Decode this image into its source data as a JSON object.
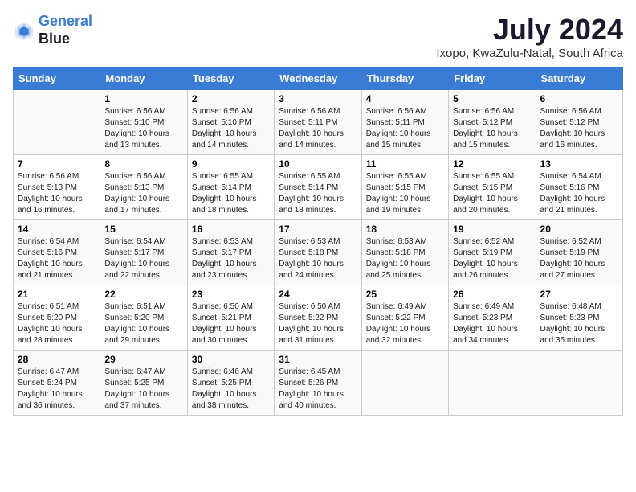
{
  "logo": {
    "line1": "General",
    "line2": "Blue"
  },
  "title": {
    "month": "July 2024",
    "location": "Ixopo, KwaZulu-Natal, South Africa"
  },
  "headers": [
    "Sunday",
    "Monday",
    "Tuesday",
    "Wednesday",
    "Thursday",
    "Friday",
    "Saturday"
  ],
  "weeks": [
    [
      {
        "day": "",
        "sunrise": "",
        "sunset": "",
        "daylight": ""
      },
      {
        "day": "1",
        "sunrise": "Sunrise: 6:56 AM",
        "sunset": "Sunset: 5:10 PM",
        "daylight": "Daylight: 10 hours and 13 minutes."
      },
      {
        "day": "2",
        "sunrise": "Sunrise: 6:56 AM",
        "sunset": "Sunset: 5:10 PM",
        "daylight": "Daylight: 10 hours and 14 minutes."
      },
      {
        "day": "3",
        "sunrise": "Sunrise: 6:56 AM",
        "sunset": "Sunset: 5:11 PM",
        "daylight": "Daylight: 10 hours and 14 minutes."
      },
      {
        "day": "4",
        "sunrise": "Sunrise: 6:56 AM",
        "sunset": "Sunset: 5:11 PM",
        "daylight": "Daylight: 10 hours and 15 minutes."
      },
      {
        "day": "5",
        "sunrise": "Sunrise: 6:56 AM",
        "sunset": "Sunset: 5:12 PM",
        "daylight": "Daylight: 10 hours and 15 minutes."
      },
      {
        "day": "6",
        "sunrise": "Sunrise: 6:56 AM",
        "sunset": "Sunset: 5:12 PM",
        "daylight": "Daylight: 10 hours and 16 minutes."
      }
    ],
    [
      {
        "day": "7",
        "sunrise": "Sunrise: 6:56 AM",
        "sunset": "Sunset: 5:13 PM",
        "daylight": "Daylight: 10 hours and 16 minutes."
      },
      {
        "day": "8",
        "sunrise": "Sunrise: 6:56 AM",
        "sunset": "Sunset: 5:13 PM",
        "daylight": "Daylight: 10 hours and 17 minutes."
      },
      {
        "day": "9",
        "sunrise": "Sunrise: 6:55 AM",
        "sunset": "Sunset: 5:14 PM",
        "daylight": "Daylight: 10 hours and 18 minutes."
      },
      {
        "day": "10",
        "sunrise": "Sunrise: 6:55 AM",
        "sunset": "Sunset: 5:14 PM",
        "daylight": "Daylight: 10 hours and 18 minutes."
      },
      {
        "day": "11",
        "sunrise": "Sunrise: 6:55 AM",
        "sunset": "Sunset: 5:15 PM",
        "daylight": "Daylight: 10 hours and 19 minutes."
      },
      {
        "day": "12",
        "sunrise": "Sunrise: 6:55 AM",
        "sunset": "Sunset: 5:15 PM",
        "daylight": "Daylight: 10 hours and 20 minutes."
      },
      {
        "day": "13",
        "sunrise": "Sunrise: 6:54 AM",
        "sunset": "Sunset: 5:16 PM",
        "daylight": "Daylight: 10 hours and 21 minutes."
      }
    ],
    [
      {
        "day": "14",
        "sunrise": "Sunrise: 6:54 AM",
        "sunset": "Sunset: 5:16 PM",
        "daylight": "Daylight: 10 hours and 21 minutes."
      },
      {
        "day": "15",
        "sunrise": "Sunrise: 6:54 AM",
        "sunset": "Sunset: 5:17 PM",
        "daylight": "Daylight: 10 hours and 22 minutes."
      },
      {
        "day": "16",
        "sunrise": "Sunrise: 6:53 AM",
        "sunset": "Sunset: 5:17 PM",
        "daylight": "Daylight: 10 hours and 23 minutes."
      },
      {
        "day": "17",
        "sunrise": "Sunrise: 6:53 AM",
        "sunset": "Sunset: 5:18 PM",
        "daylight": "Daylight: 10 hours and 24 minutes."
      },
      {
        "day": "18",
        "sunrise": "Sunrise: 6:53 AM",
        "sunset": "Sunset: 5:18 PM",
        "daylight": "Daylight: 10 hours and 25 minutes."
      },
      {
        "day": "19",
        "sunrise": "Sunrise: 6:52 AM",
        "sunset": "Sunset: 5:19 PM",
        "daylight": "Daylight: 10 hours and 26 minutes."
      },
      {
        "day": "20",
        "sunrise": "Sunrise: 6:52 AM",
        "sunset": "Sunset: 5:19 PM",
        "daylight": "Daylight: 10 hours and 27 minutes."
      }
    ],
    [
      {
        "day": "21",
        "sunrise": "Sunrise: 6:51 AM",
        "sunset": "Sunset: 5:20 PM",
        "daylight": "Daylight: 10 hours and 28 minutes."
      },
      {
        "day": "22",
        "sunrise": "Sunrise: 6:51 AM",
        "sunset": "Sunset: 5:20 PM",
        "daylight": "Daylight: 10 hours and 29 minutes."
      },
      {
        "day": "23",
        "sunrise": "Sunrise: 6:50 AM",
        "sunset": "Sunset: 5:21 PM",
        "daylight": "Daylight: 10 hours and 30 minutes."
      },
      {
        "day": "24",
        "sunrise": "Sunrise: 6:50 AM",
        "sunset": "Sunset: 5:22 PM",
        "daylight": "Daylight: 10 hours and 31 minutes."
      },
      {
        "day": "25",
        "sunrise": "Sunrise: 6:49 AM",
        "sunset": "Sunset: 5:22 PM",
        "daylight": "Daylight: 10 hours and 32 minutes."
      },
      {
        "day": "26",
        "sunrise": "Sunrise: 6:49 AM",
        "sunset": "Sunset: 5:23 PM",
        "daylight": "Daylight: 10 hours and 34 minutes."
      },
      {
        "day": "27",
        "sunrise": "Sunrise: 6:48 AM",
        "sunset": "Sunset: 5:23 PM",
        "daylight": "Daylight: 10 hours and 35 minutes."
      }
    ],
    [
      {
        "day": "28",
        "sunrise": "Sunrise: 6:47 AM",
        "sunset": "Sunset: 5:24 PM",
        "daylight": "Daylight: 10 hours and 36 minutes."
      },
      {
        "day": "29",
        "sunrise": "Sunrise: 6:47 AM",
        "sunset": "Sunset: 5:25 PM",
        "daylight": "Daylight: 10 hours and 37 minutes."
      },
      {
        "day": "30",
        "sunrise": "Sunrise: 6:46 AM",
        "sunset": "Sunset: 5:25 PM",
        "daylight": "Daylight: 10 hours and 38 minutes."
      },
      {
        "day": "31",
        "sunrise": "Sunrise: 6:45 AM",
        "sunset": "Sunset: 5:26 PM",
        "daylight": "Daylight: 10 hours and 40 minutes."
      },
      {
        "day": "",
        "sunrise": "",
        "sunset": "",
        "daylight": ""
      },
      {
        "day": "",
        "sunrise": "",
        "sunset": "",
        "daylight": ""
      },
      {
        "day": "",
        "sunrise": "",
        "sunset": "",
        "daylight": ""
      }
    ]
  ]
}
